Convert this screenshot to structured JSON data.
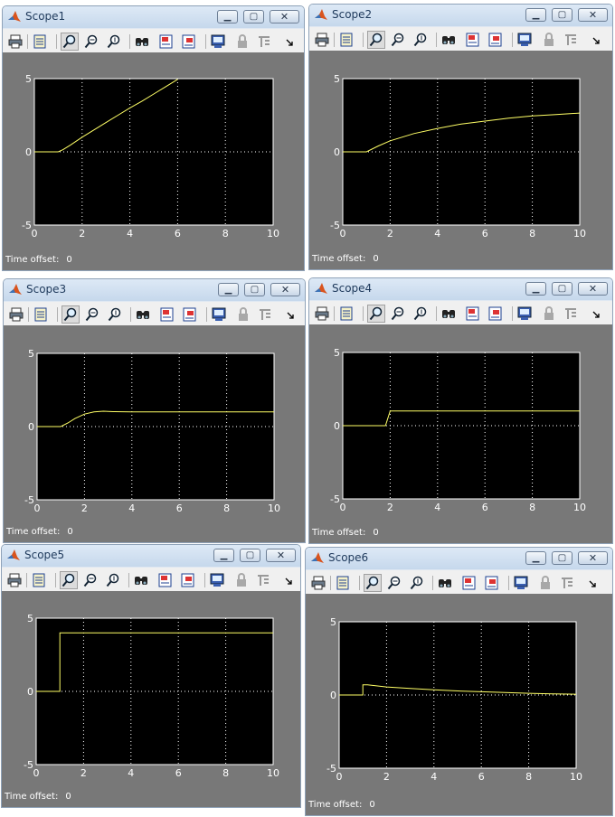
{
  "colors": {
    "plot_bg": "#000000",
    "axes_bg": "#787878",
    "trace": "#ffff66",
    "grid": "#ffffff"
  },
  "toolbar_icons": [
    "print-icon",
    "parameters-icon",
    "zoom-icon",
    "zoom-x-icon",
    "zoom-y-icon",
    "autoscale-icon",
    "save-axes-icon",
    "restore-axes-icon",
    "floating-scope-icon",
    "lock-icon",
    "signal-selection-icon",
    "more-icon"
  ],
  "windows": [
    {
      "title": "Scope1",
      "offset_label": "Time offset:",
      "offset_value": "0",
      "chart_data": {
        "type": "line",
        "xlim": [
          0,
          10
        ],
        "ylim": [
          -5,
          5
        ],
        "x_ticks": [
          "0",
          "2",
          "4",
          "6",
          "8",
          "10"
        ],
        "y_ticks": [
          "5",
          "0",
          "-5"
        ],
        "grid": true,
        "x": [
          0,
          1,
          1.2,
          1.5,
          2,
          2.5,
          3,
          3.5,
          4,
          4.5,
          5,
          5.5,
          6
        ],
        "y": [
          0,
          0,
          0.15,
          0.45,
          1.0,
          1.5,
          2.0,
          2.5,
          3.0,
          3.45,
          3.95,
          4.45,
          4.95
        ]
      }
    },
    {
      "title": "Scope2",
      "offset_label": "Time offset:",
      "offset_value": "0",
      "chart_data": {
        "type": "line",
        "xlim": [
          0,
          10
        ],
        "ylim": [
          -5,
          5
        ],
        "x_ticks": [
          "0",
          "2",
          "4",
          "6",
          "8",
          "10"
        ],
        "y_ticks": [
          "5",
          "0",
          "-5"
        ],
        "grid": true,
        "x": [
          0,
          1,
          1.5,
          2,
          2.5,
          3,
          4,
          5,
          6,
          7,
          8,
          9,
          10
        ],
        "y": [
          0,
          0,
          0.4,
          0.75,
          1.0,
          1.25,
          1.6,
          1.9,
          2.1,
          2.3,
          2.45,
          2.55,
          2.65
        ]
      }
    },
    {
      "title": "Scope3",
      "offset_label": "Time offset:",
      "offset_value": "0",
      "chart_data": {
        "type": "line",
        "xlim": [
          0,
          10
        ],
        "ylim": [
          -5,
          5
        ],
        "x_ticks": [
          "0",
          "2",
          "4",
          "6",
          "8",
          "10"
        ],
        "y_ticks": [
          "5",
          "0",
          "-5"
        ],
        "grid": true,
        "x": [
          0,
          1,
          1.3,
          1.6,
          2,
          2.4,
          2.8,
          3.2,
          4,
          6,
          8,
          10
        ],
        "y": [
          0,
          0,
          0.25,
          0.55,
          0.85,
          1.0,
          1.05,
          1.02,
          1.0,
          1.0,
          1.0,
          1.0
        ]
      }
    },
    {
      "title": "Scope4",
      "offset_label": "Time offset:",
      "offset_value": "0",
      "chart_data": {
        "type": "line",
        "xlim": [
          0,
          10
        ],
        "ylim": [
          -5,
          5
        ],
        "x_ticks": [
          "0",
          "2",
          "4",
          "6",
          "8",
          "10"
        ],
        "y_ticks": [
          "5",
          "0",
          "-5"
        ],
        "grid": true,
        "x": [
          0,
          1.8,
          2.0,
          2.05,
          10
        ],
        "y": [
          0,
          0,
          1.0,
          1.0,
          1.0
        ]
      }
    },
    {
      "title": "Scope5",
      "offset_label": "Time offset:",
      "offset_value": "0",
      "chart_data": {
        "type": "line",
        "xlim": [
          0,
          10
        ],
        "ylim": [
          -5,
          5
        ],
        "x_ticks": [
          "0",
          "2",
          "4",
          "6",
          "8",
          "10"
        ],
        "y_ticks": [
          "5",
          "0",
          "-5"
        ],
        "grid": true,
        "x": [
          0,
          1,
          1,
          10
        ],
        "y": [
          0,
          0,
          4,
          4
        ]
      }
    },
    {
      "title": "Scope6",
      "offset_label": "Time offset:",
      "offset_value": "0",
      "chart_data": {
        "type": "line",
        "xlim": [
          0,
          10
        ],
        "ylim": [
          -5,
          5
        ],
        "x_ticks": [
          "0",
          "2",
          "4",
          "6",
          "8",
          "10"
        ],
        "y_ticks": [
          "5",
          "0",
          "-5"
        ],
        "grid": true,
        "x": [
          0,
          1,
          1,
          1.2,
          2,
          3,
          4,
          5,
          6,
          7,
          8,
          9,
          10
        ],
        "y": [
          0,
          0,
          0.7,
          0.7,
          0.55,
          0.45,
          0.35,
          0.28,
          0.22,
          0.17,
          0.12,
          0.08,
          0.05
        ]
      }
    }
  ]
}
